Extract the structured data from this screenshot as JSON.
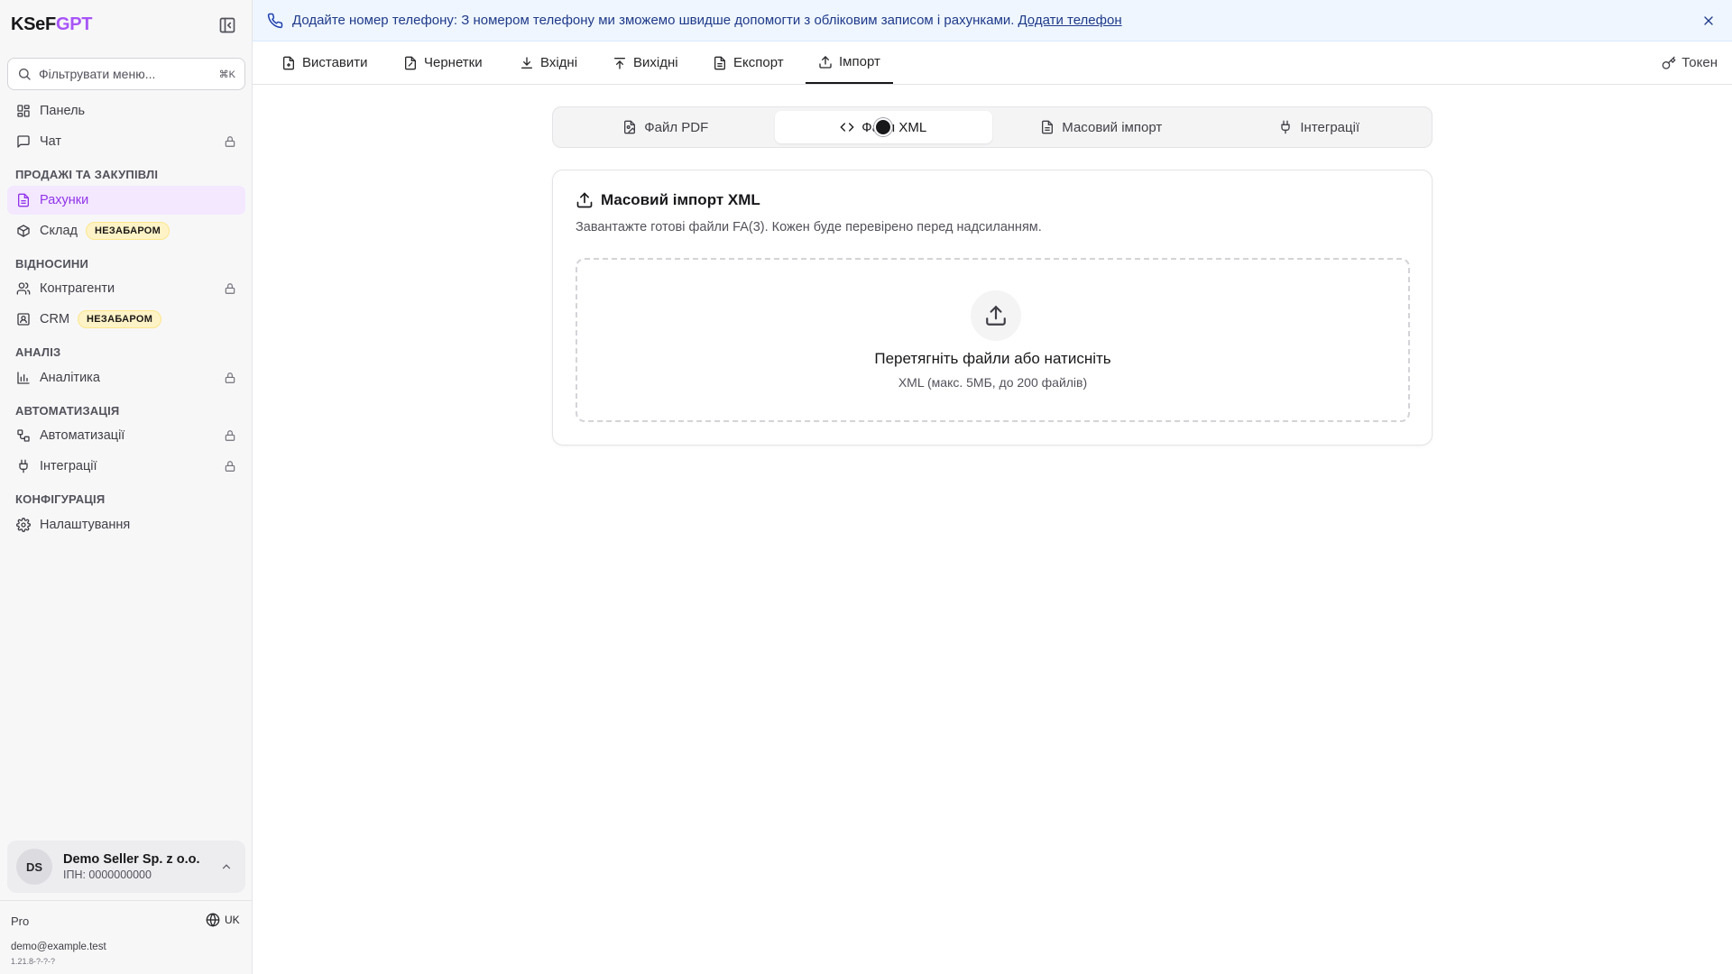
{
  "sidebar": {
    "logo_part1": "KSeF",
    "logo_part2": "GPT",
    "filter_placeholder": "Фільтрувати меню...",
    "filter_shortcut": "⌘K",
    "items": {
      "panel": "Панель",
      "chat": "Чат",
      "invoices": "Рахунки",
      "warehouse": "Склад",
      "contractors": "Контрагенти",
      "crm": "CRM",
      "analytics": "Аналітика",
      "automations": "Автоматизації",
      "integrations": "Інтеграції",
      "settings": "Налаштування"
    },
    "sections": {
      "sales": "ПРОДАЖІ ТА ЗАКУПІВЛІ",
      "relations": "ВІДНОСИНИ",
      "analysis": "АНАЛІЗ",
      "automation": "АВТОМАТИЗАЦІЯ",
      "config": "КОНФІГУРАЦІЯ"
    },
    "soon_badge": "НЕЗАБАРОМ",
    "account": {
      "initials": "DS",
      "name": "Demo Seller Sp. z o.o.",
      "nip": "ІПН: 0000000000"
    },
    "plan": "Pro",
    "language": "UK",
    "email": "demo@example.test",
    "version": "1.21.8-?-?-?"
  },
  "banner": {
    "message": "Додайте номер телефону: З номером телефону ми зможемо швидше допомогти з обліковим записом і рахунками.",
    "link": "Додати телефон"
  },
  "top_tabs": {
    "issue": "Виставити",
    "drafts": "Чернетки",
    "incoming": "Вхідні",
    "outgoing": "Вихідні",
    "export": "Експорт",
    "import": "Імпорт",
    "active": "Імпорт"
  },
  "token_label": "Токен",
  "sub_tabs": {
    "pdf": "Файл PDF",
    "xml": "Файл XML",
    "bulk": "Масовий імпорт",
    "integrations": "Інтеграції",
    "active": "Файл XML"
  },
  "card": {
    "title": "Масовий імпорт XML",
    "description": "Завантажте готові файли FA(3). Кожен буде перевірено перед надсиланням.",
    "dropzone_title": "Перетягніть файли або натисніть",
    "dropzone_hint": "XML (макс. 5МБ, до 200 файлів)"
  },
  "colors": {
    "accent": "#9333ea",
    "badge_bg": "#fef3c7",
    "banner_bg": "#eff6ff",
    "banner_text": "#1e3a8a"
  }
}
